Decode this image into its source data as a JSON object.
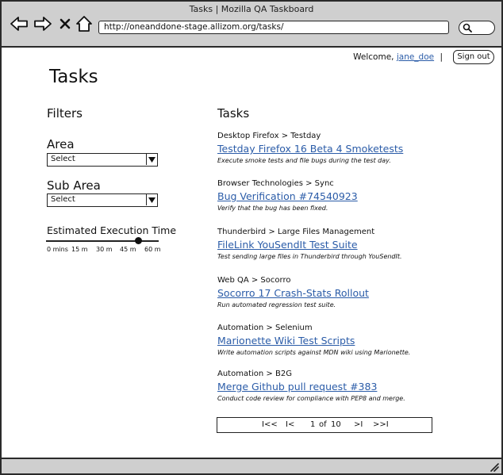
{
  "window": {
    "title": "Tasks | Mozilla QA Taskboard",
    "url": "http://oneanddone-stage.allizom.org/tasks/"
  },
  "header": {
    "welcome_text": "Welcome,",
    "username": "jane_doe",
    "separator": "|",
    "signout_label": "Sign out"
  },
  "page": {
    "title": "Tasks"
  },
  "filters": {
    "heading": "Filters",
    "area_label": "Area",
    "area_value": "Select",
    "subarea_label": "Sub Area",
    "subarea_value": "Select",
    "time_label": "Estimated Execution Time",
    "time_ticks": [
      "0 mins",
      "15 m",
      "30 m",
      "45 m",
      "60 m"
    ],
    "time_value_fraction": 0.82
  },
  "tasks": {
    "heading": "Tasks",
    "items": [
      {
        "crumb": "Desktop Firefox > Testday",
        "title": "Testday Firefox 16 Beta 4 Smoketests",
        "desc": "Execute smoke tests and file bugs during the test day."
      },
      {
        "crumb": "Browser Technologies > Sync",
        "title": "Bug Verification #74540923",
        "desc": "Verify that the bug has been fixed."
      },
      {
        "crumb": "Thunderbird > Large Files Management",
        "title": "FileLink YouSendIt Test Suite",
        "desc": "Test sending large files in Thunderbird through YouSendIt."
      },
      {
        "crumb": "Web QA > Socorro",
        "title": "Socorro 17 Crash-Stats Rollout",
        "desc": "Run automated regression test suite."
      },
      {
        "crumb": "Automation > Selenium",
        "title": "Marionette Wiki Test Scripts",
        "desc": "Write automation scripts against MDN wiki using Marionette."
      },
      {
        "crumb": "Automation > B2G",
        "title": "Merge Github pull request #383",
        "desc": "Conduct code review for compliance with PEP8 and merge."
      }
    ]
  },
  "pager": {
    "first": "I<<",
    "prev": "I<",
    "current": "1",
    "of": "of",
    "total": "10",
    "next": ">I",
    "last": ">>I"
  },
  "colors": {
    "link": "#2b5ca8",
    "chrome": "#cfcfcf"
  }
}
